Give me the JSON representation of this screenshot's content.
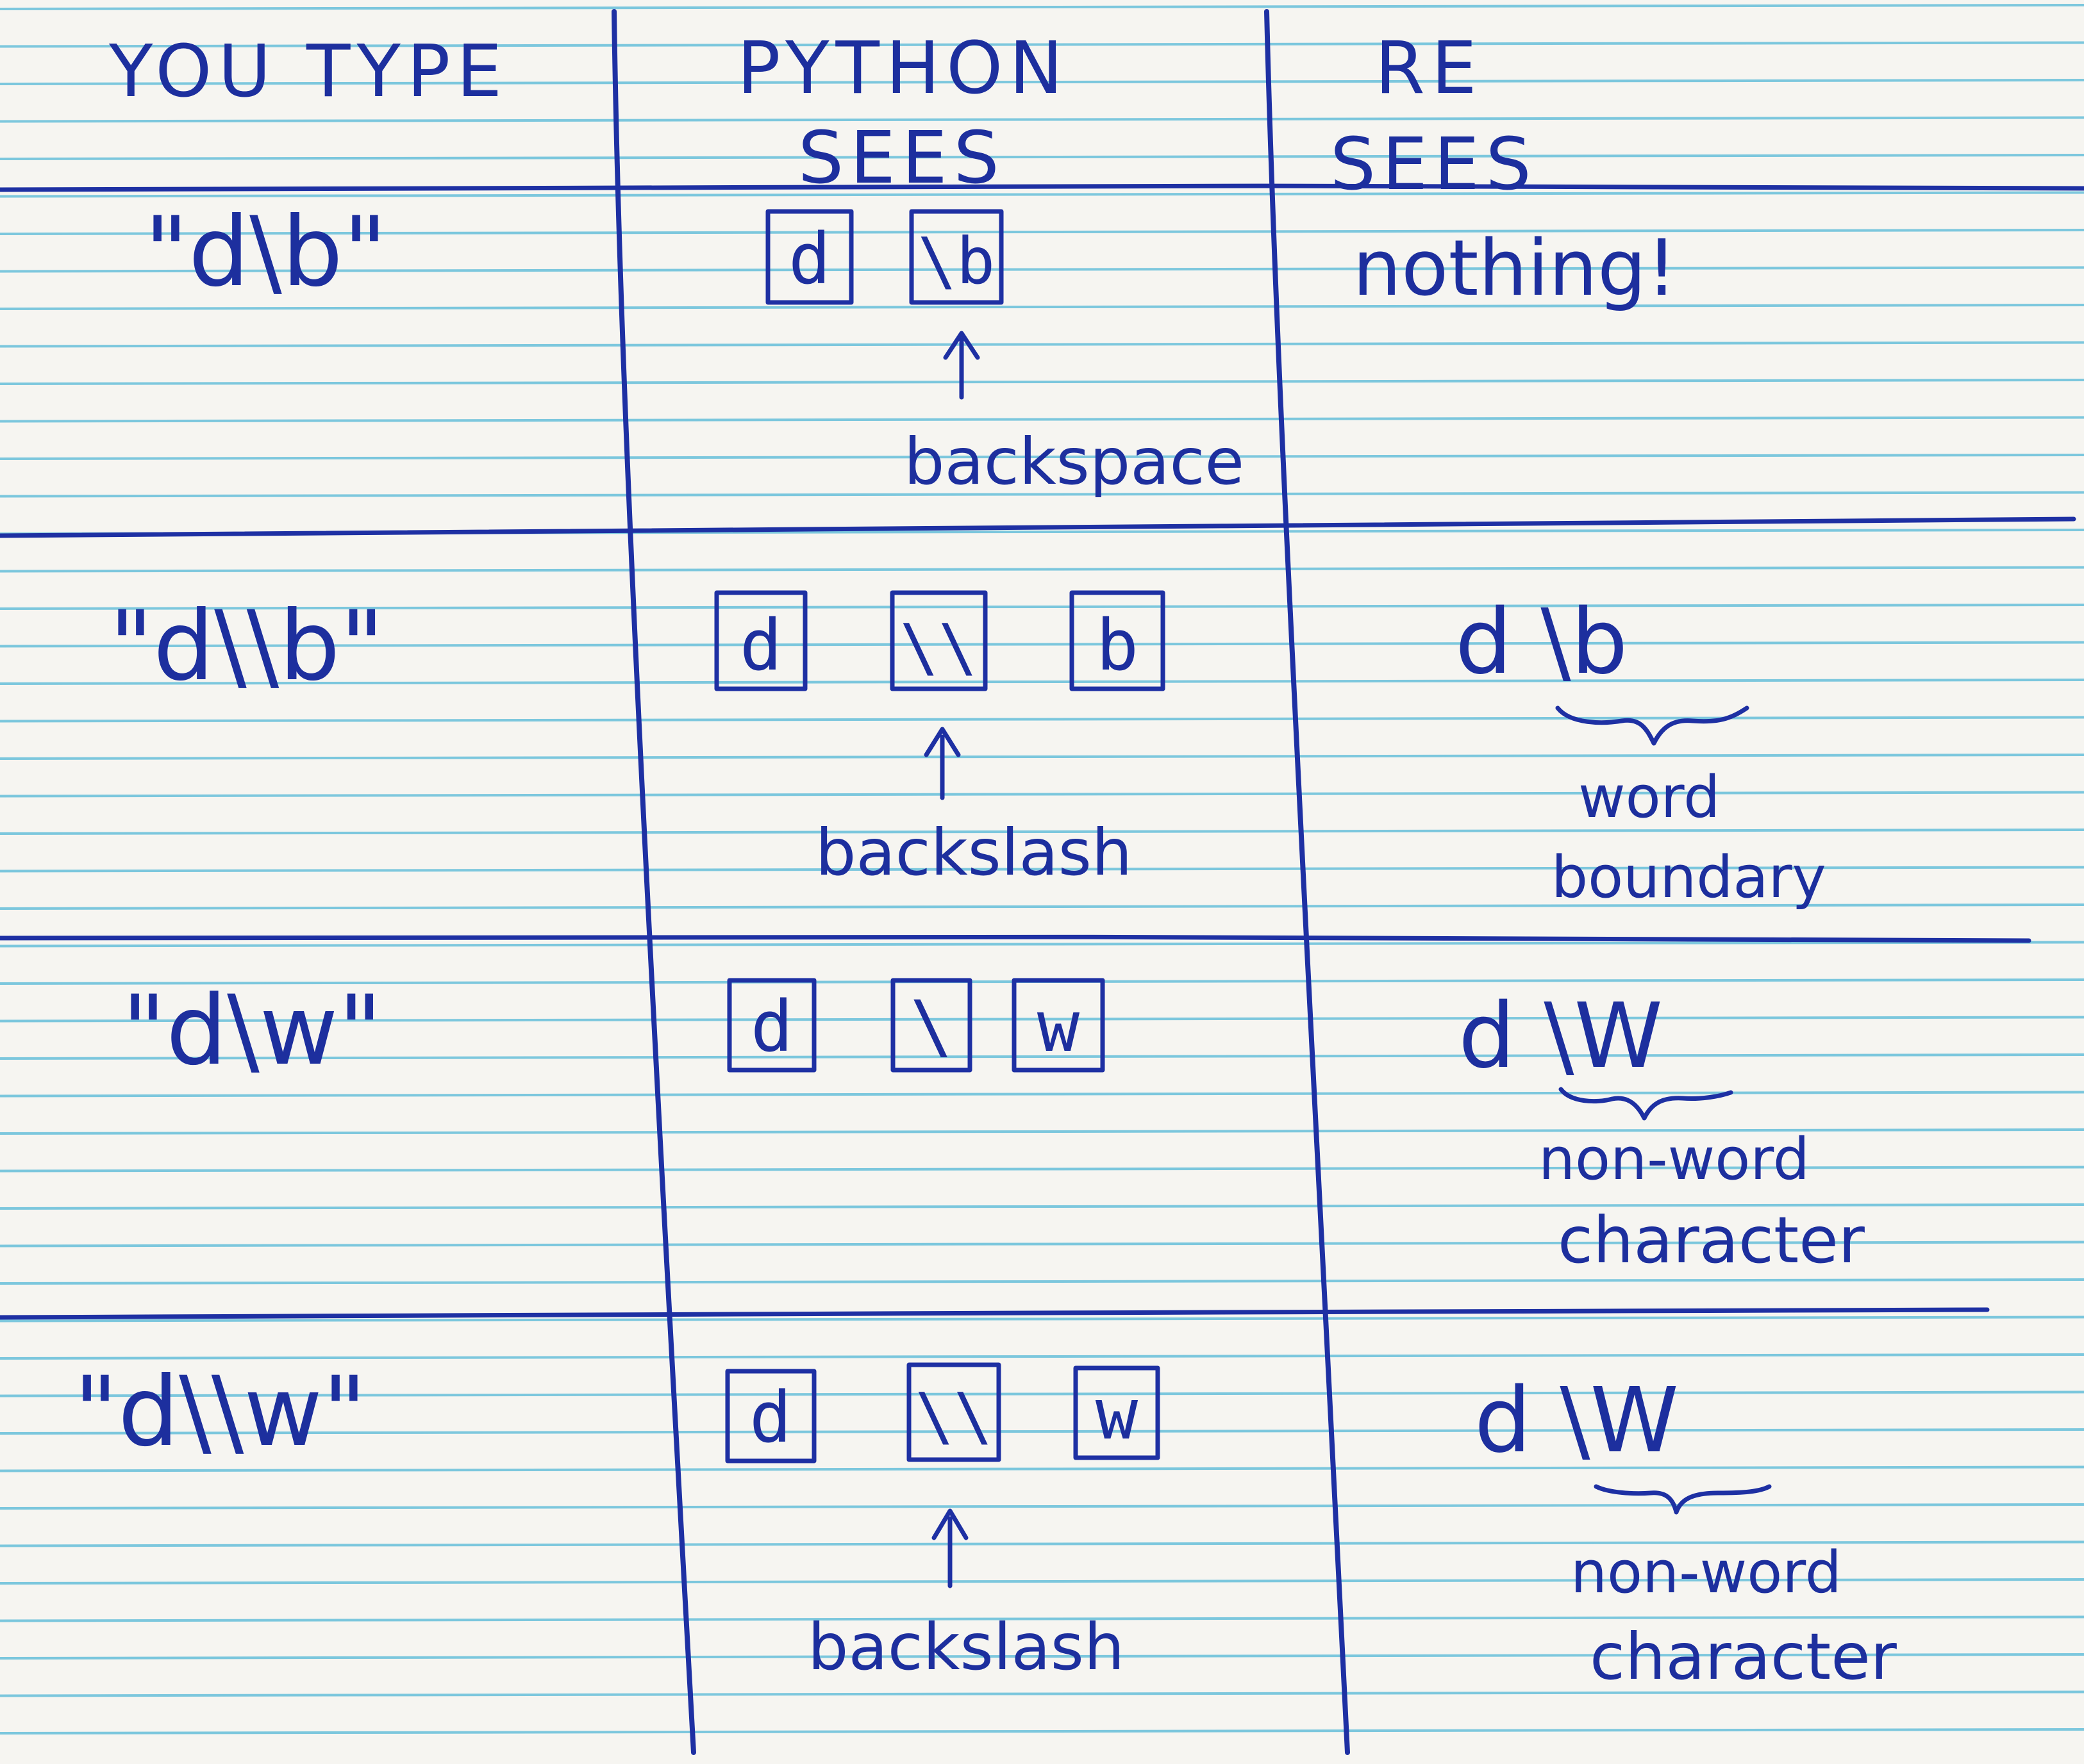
{
  "headers": {
    "col1": "YOU TYPE",
    "col2_line1": "PYTHON",
    "col2_line2": "SEES",
    "col3_line1": "RE",
    "col3_line2": "SEES"
  },
  "rows": [
    {
      "typed": "\"d\\b\"",
      "python_chars": [
        "d",
        "\\b"
      ],
      "python_note": "backspace",
      "re_main": "nothing!",
      "re_sub_line1": "",
      "re_sub_line2": ""
    },
    {
      "typed": "\"d\\\\b\"",
      "python_chars": [
        "d",
        "\\\\",
        "b"
      ],
      "python_note": "backslash",
      "re_main": "d \\b",
      "re_sub_line1": "word",
      "re_sub_line2": "boundary"
    },
    {
      "typed": "\"d\\w\"",
      "python_chars": [
        "d",
        "\\",
        "w"
      ],
      "python_note": "",
      "re_main": "d \\W",
      "re_sub_line1": "non-word",
      "re_sub_line2": "character"
    },
    {
      "typed": "\"d\\\\w\"",
      "python_chars": [
        "d",
        "\\\\",
        "w"
      ],
      "python_note": "backslash",
      "re_main": "d \\W",
      "re_sub_line1": "non-word",
      "re_sub_line2": "character"
    }
  ],
  "colors": {
    "ink": "#1d2f9e",
    "ruled_line": "#7cc7dd",
    "paper": "#f6f5f1"
  }
}
